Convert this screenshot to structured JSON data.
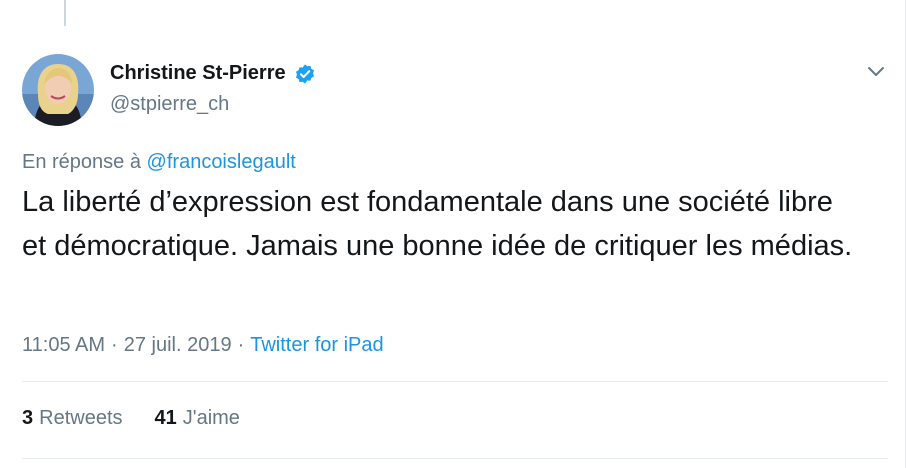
{
  "tweet": {
    "display_name": "Christine St-Pierre",
    "handle": "@stpierre_ch",
    "reply_prefix": "En réponse à",
    "reply_mention": "@francoislegault",
    "text": "La liberté d’expression est fondamentale dans une société libre et démocratique. Jamais une bonne idée de critiquer les médias.",
    "time": "11:05 AM",
    "date": "27 juil. 2019",
    "separator": "·",
    "source": "Twitter for iPad",
    "retweets_count": "3",
    "retweets_label": "Retweets",
    "likes_count": "41",
    "likes_label": "J'aime"
  },
  "icons": {
    "verified": "verified-badge-icon",
    "more": "chevron-down-icon"
  },
  "colors": {
    "link": "#1b95e0",
    "secondary_text": "#657786",
    "primary_text": "#14171a",
    "verified": "#1da1f2"
  }
}
